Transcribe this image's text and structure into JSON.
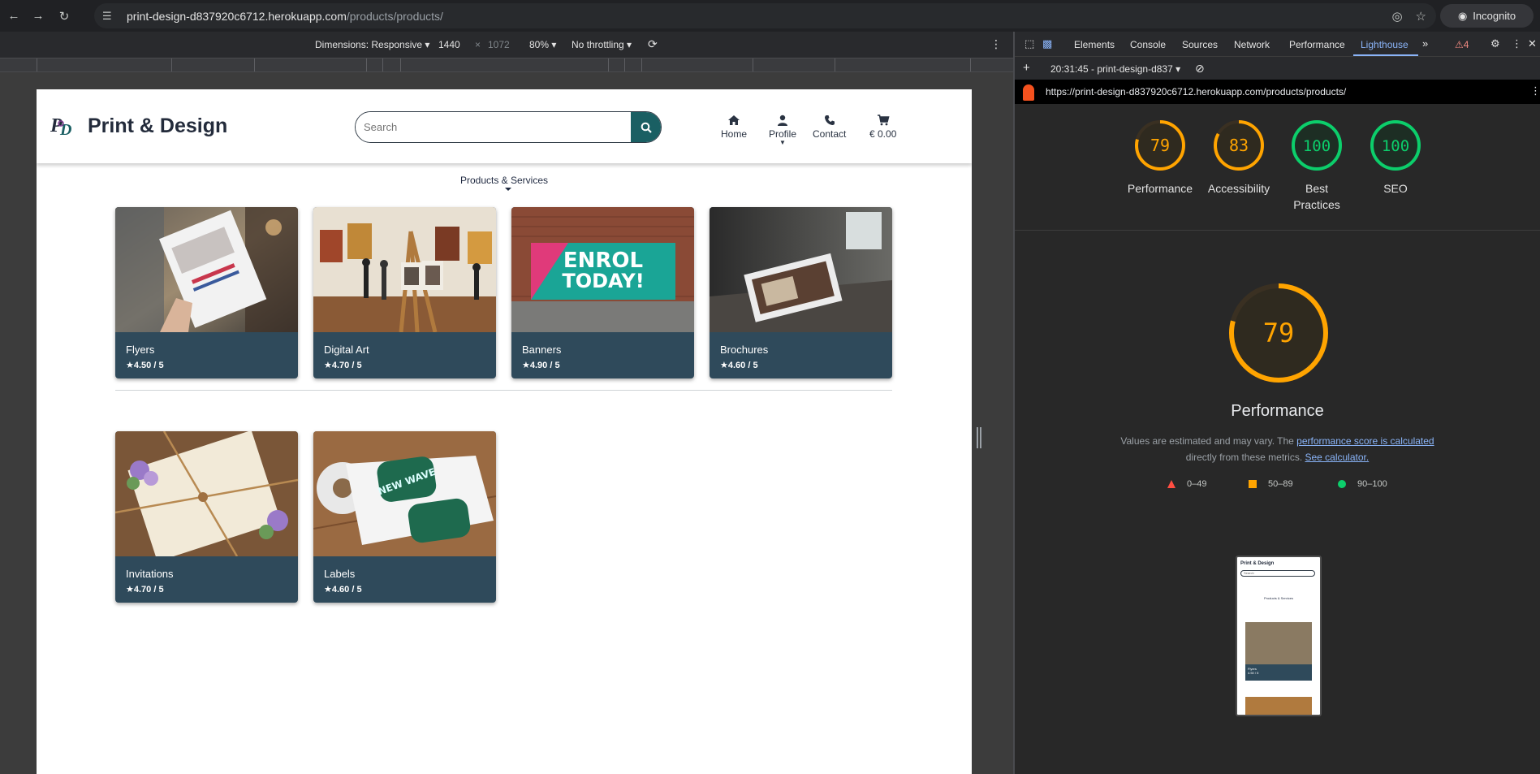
{
  "browser": {
    "url_host": "print-design-d837920c6712.herokuapp.com",
    "url_path": "/products/products/",
    "incognito_label": "Incognito"
  },
  "device_toolbar": {
    "dimensions_label": "Dimensions: Responsive",
    "width": "1440",
    "height": "1072",
    "times": "×",
    "zoom": "80%",
    "throttling": "No throttling"
  },
  "site": {
    "logo_mark": "P&D",
    "logo_text": "Print & Design",
    "search_placeholder": "Search",
    "nav": {
      "home": "Home",
      "profile": "Profile",
      "contact": "Contact",
      "cart": "€ 0.00"
    },
    "category_title": "Products & Services",
    "products": [
      {
        "name": "Flyers",
        "rating": "4.50 / 5"
      },
      {
        "name": "Digital Art",
        "rating": "4.70 / 5"
      },
      {
        "name": "Banners",
        "rating": "4.90 / 5"
      },
      {
        "name": "Brochures",
        "rating": "4.60 / 5"
      },
      {
        "name": "Invitations",
        "rating": "4.70 / 5"
      },
      {
        "name": "Labels",
        "rating": "4.60 / 5"
      }
    ],
    "banner_text_1": "ENROL",
    "banner_text_2": "TODAY!",
    "label_text": "NEW WAVE"
  },
  "devtools": {
    "tabs": [
      "Elements",
      "Console",
      "Sources",
      "Network",
      "Performance",
      "Lighthouse"
    ],
    "active_tab": "Lighthouse",
    "warning_count": "4",
    "report_selector": "20:31:45 - print-design-d837",
    "report_url": "https://print-design-d837920c6712.herokuapp.com/products/products/",
    "scores": [
      {
        "label": "Performance",
        "value": 79,
        "color": "#ffa400"
      },
      {
        "label": "Accessibility",
        "value": 83,
        "color": "#ffa400"
      },
      {
        "label": "Best Practices",
        "value": 100,
        "color": "#0cce6b"
      },
      {
        "label": "SEO",
        "value": 100,
        "color": "#0cce6b"
      }
    ],
    "main_score": 79,
    "main_title": "Performance",
    "note_prefix": "Values are estimated and may vary. The ",
    "note_link1": "performance score is calculated",
    "note_middle": "directly from these metrics. ",
    "note_link2": "See calculator.",
    "legend": [
      "0–49",
      "50–89",
      "90–100"
    ],
    "thumb_title": "Print & Design",
    "thumb_search": "Search",
    "thumb_category": "Products & Services",
    "thumb_product": "Flyers",
    "thumb_rating": "4.50 / 5"
  }
}
